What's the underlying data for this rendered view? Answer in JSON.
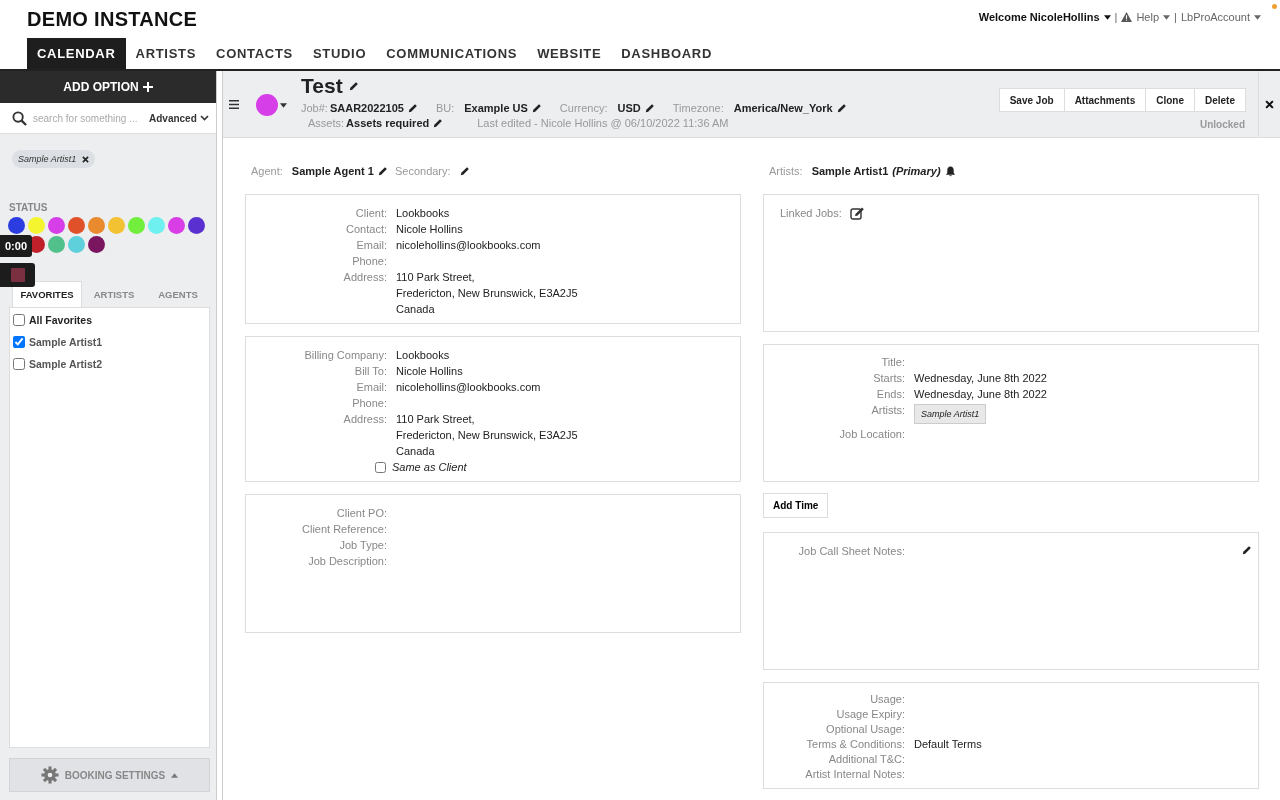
{
  "app_title": "DEMO INSTANCE",
  "menu_separator": "|",
  "user_menu": [
    {
      "label": "Welcome NicoleHollins",
      "kind": "user"
    },
    {
      "label": "Help",
      "kind": "help"
    },
    {
      "label": "LbProAccount",
      "kind": "account"
    }
  ],
  "nav": [
    {
      "label": "CALENDAR",
      "selected": true
    },
    {
      "label": "ARTISTS",
      "selected": false
    },
    {
      "label": "CONTACTS",
      "selected": false
    },
    {
      "label": "STUDIO",
      "selected": false
    },
    {
      "label": "COMMUNICATIONS",
      "selected": false
    },
    {
      "label": "WEBSITE",
      "selected": false
    },
    {
      "label": "DASHBOARD",
      "selected": false
    }
  ],
  "sidebar": {
    "add_button": "ADD OPTION",
    "search": {
      "placeholder": "search for something ...",
      "advanced": "Advanced"
    },
    "filter_chips": [
      "Sample Artist1"
    ],
    "status_title": "STATUS",
    "status_rows": [
      [
        {
          "color": "#2b3de0"
        },
        {
          "color": "#f4f52e"
        },
        {
          "color": "#d63ee8"
        },
        {
          "color": "#e0512a"
        },
        {
          "color": "#ea8a2e"
        },
        {
          "color": "#f2c232"
        },
        {
          "color": "#72ee3c"
        },
        {
          "color": "#6ef0f0"
        },
        {
          "color": "#d93ee6"
        },
        {
          "color": "#5b30d0"
        }
      ],
      [
        {
          "color": "#c0202a"
        },
        {
          "color": "#52c08a"
        },
        {
          "color": "#5ed0dc"
        },
        {
          "color": "#7a1660"
        }
      ]
    ],
    "tabs": [
      {
        "label": "FAVORITES",
        "selected": true
      },
      {
        "label": "ARTISTS",
        "selected": false
      },
      {
        "label": "AGENTS",
        "selected": false
      }
    ],
    "favorites": [
      {
        "label": "All Favorites",
        "checked": false,
        "kind": "all"
      },
      {
        "label": "Sample Artist1",
        "checked": true,
        "kind": "item"
      },
      {
        "label": "Sample Artist2",
        "checked": false,
        "kind": "item"
      }
    ],
    "settings_button": "BOOKING SETTINGS"
  },
  "recorder": {
    "time": "0:00"
  },
  "job": {
    "title": "Test",
    "color": "#d63ee8",
    "meta": [
      {
        "label": "Job#:",
        "value": "SAAR2022105"
      },
      {
        "label": "BU:",
        "value": "Example US"
      },
      {
        "label": "Currency:",
        "value": "USD"
      },
      {
        "label": "Timezone:",
        "value": "America/New_York"
      }
    ],
    "assets": {
      "label": "Assets:",
      "value": "Assets required"
    },
    "last_edited": "Last edited - Nicole Hollins @ 06/10/2022 11:36 AM",
    "buttons": [
      "Save Job",
      "Attachments",
      "Clone",
      "Delete"
    ],
    "lock_status": "Unlocked"
  },
  "agent": {
    "label": "Agent:",
    "value": "Sample Agent 1",
    "secondary_label": "Secondary:"
  },
  "artists": {
    "label": "Artists:",
    "value": "Sample Artist1",
    "role": "(Primary)"
  },
  "left_cards": [
    {
      "fields": [
        {
          "label": "Client:",
          "lines": [
            "Lookbooks"
          ]
        },
        {
          "label": "Contact:",
          "lines": [
            "Nicole Hollins"
          ]
        },
        {
          "label": "Email:",
          "lines": [
            "nicolehollins@lookbooks.com"
          ]
        },
        {
          "label": "Phone:"
        },
        {
          "label": "Address:",
          "lines": [
            "110 Park Street,",
            "Fredericton, New Brunswick, E3A2J5",
            "Canada"
          ]
        }
      ]
    },
    {
      "fields": [
        {
          "label": "Billing Company:",
          "lines": [
            "Lookbooks"
          ]
        },
        {
          "label": "Bill To:",
          "lines": [
            "Nicole Hollins"
          ]
        },
        {
          "label": "Email:",
          "lines": [
            "nicolehollins@lookbooks.com"
          ]
        },
        {
          "label": "Phone:"
        },
        {
          "label": "Address:",
          "lines": [
            "110 Park Street,",
            "Fredericton, New Brunswick, E3A2J5",
            "Canada"
          ]
        }
      ],
      "checkbox": {
        "label": "Same as Client",
        "checked": false
      }
    },
    {
      "fields": [
        {
          "label": "Client PO:"
        },
        {
          "label": "Client Reference:"
        },
        {
          "label": "Job Type:"
        },
        {
          "label": "Job Description:"
        }
      ]
    }
  ],
  "linked_jobs": {
    "label": "Linked Jobs:"
  },
  "schedule": {
    "fields": [
      {
        "label": "Title:"
      },
      {
        "label": "Starts:",
        "lines": [
          "Wednesday, June 8th 2022"
        ]
      },
      {
        "label": "Ends:",
        "lines": [
          "Wednesday, June 8th 2022"
        ]
      },
      {
        "label": "Artists:",
        "chips": [
          "Sample Artist1"
        ]
      },
      {
        "label": "Job Location:"
      }
    ]
  },
  "add_time_button": "Add Time",
  "notes": {
    "label": "Job Call Sheet Notes:"
  },
  "usage": {
    "fields": [
      {
        "label": "Usage:"
      },
      {
        "label": "Usage Expiry:"
      },
      {
        "label": "Optional Usage:"
      },
      {
        "label": "Terms & Conditions:",
        "lines": [
          "Default Terms"
        ]
      },
      {
        "label": "Additional T&C:"
      },
      {
        "label": "Artist Internal Notes:"
      }
    ]
  }
}
